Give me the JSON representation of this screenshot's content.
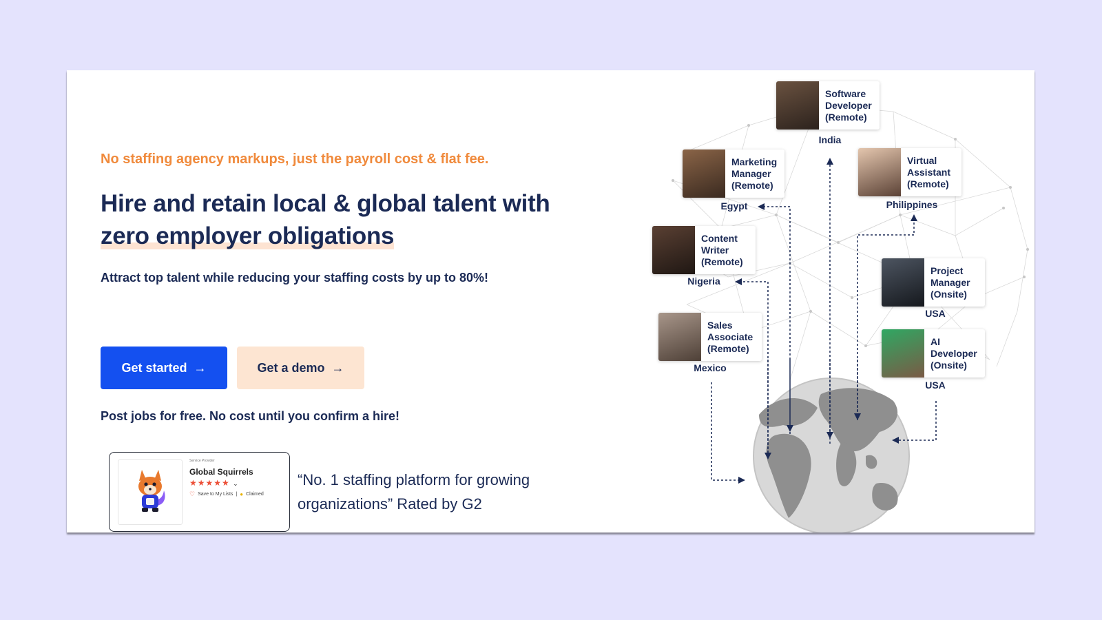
{
  "hero": {
    "tagline": "No staffing agency markups, just the payroll cost & flat fee.",
    "headline_part1": "Hire and retain local & global talent with ",
    "headline_highlight": "zero employer obligations",
    "subheadline": "Attract top talent while reducing your staffing costs by up to 80%!",
    "primary_button": "Get started",
    "secondary_button": "Get a demo",
    "button_arrow": "→",
    "note": "Post jobs for free. No cost until you confirm a hire!"
  },
  "g2_badge": {
    "provider_label": "Service Provider",
    "company_name": "Global Squirrels",
    "stars": "★★★★★",
    "stars_chevron": "⌄",
    "save_label": "Save to My Lists",
    "separator": "|",
    "claimed_label": "Claimed",
    "quote": "“No. 1 staffing platform for growing organizations” Rated by G2"
  },
  "talent_map": {
    "cards": [
      {
        "role": "Software\nDeveloper\n(Remote)",
        "country": "India",
        "photo_color": "#4a3a30"
      },
      {
        "role": "Marketing\nManager\n(Remote)",
        "country": "Egypt",
        "photo_color": "#6b4a35"
      },
      {
        "role": "Virtual\nAssistant\n(Remote)",
        "country": "Philippines",
        "photo_color": "#caa58a"
      },
      {
        "role": "Content\nWriter\n(Remote)",
        "country": "Nigeria",
        "photo_color": "#3a2a22"
      },
      {
        "role": "Project\nManager\n(Onsite)",
        "country": "USA",
        "photo_color": "#2b2f36"
      },
      {
        "role": "Sales\nAssociate\n(Remote)",
        "country": "Mexico",
        "photo_color": "#7a6a5a"
      },
      {
        "role": "AI\nDeveloper\n(Onsite)",
        "country": "USA",
        "photo_color": "#4a8a5a"
      }
    ]
  },
  "colors": {
    "page_bg": "#e4e3fd",
    "accent_orange": "#f08a3c",
    "navy": "#1b2a55",
    "primary_blue": "#1450f0",
    "peach": "#fde5d2",
    "g2_red": "#ec4f37"
  }
}
